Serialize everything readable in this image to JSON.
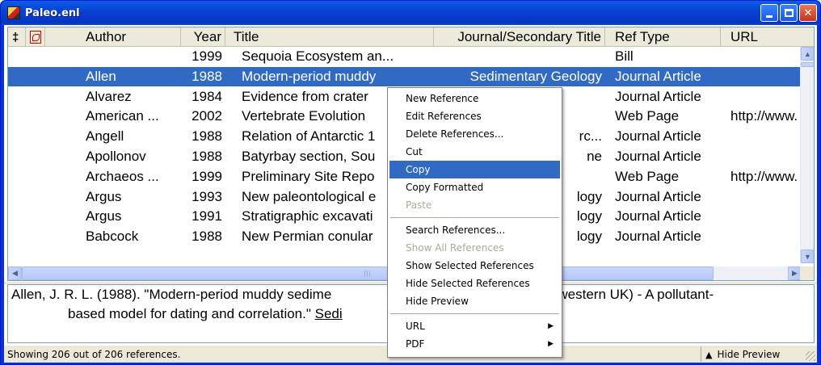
{
  "window": {
    "title": "Paleo.enl"
  },
  "columns": {
    "attach_icon": "paperclip-icon",
    "pdf_icon": "pdf-icon",
    "author": "Author",
    "year": "Year",
    "title": "Title",
    "journal": "Journal/Secondary Title",
    "reftype": "Ref Type",
    "url": "URL"
  },
  "rows": [
    {
      "author": "",
      "year": "1999",
      "title": "Sequoia Ecosystem an...",
      "journal": "",
      "reftype": "Bill",
      "url": ""
    },
    {
      "author": "Allen",
      "year": "1988",
      "title": "Modern-period muddy ",
      "journal": "Sedimentary Geology",
      "reftype": "Journal Article",
      "url": ""
    },
    {
      "author": "Alvarez",
      "year": "1984",
      "title": "Evidence from crater",
      "journal": "",
      "reftype": "Journal Article",
      "url": ""
    },
    {
      "author": "American ...",
      "year": "2002",
      "title": "Vertebrate Evolution",
      "journal": "",
      "reftype": "Web Page",
      "url": "http://www."
    },
    {
      "author": "Angell",
      "year": "1988",
      "title": "Relation of Antarctic 1",
      "journal": "rc...",
      "reftype": "Journal Article",
      "url": ""
    },
    {
      "author": "Apollonov",
      "year": "1988",
      "title": "Batyrbay section, Sou",
      "journal": "ne",
      "reftype": "Journal Article",
      "url": ""
    },
    {
      "author": "Archaeos ...",
      "year": "1999",
      "title": "Preliminary Site Repo",
      "journal": "",
      "reftype": "Web Page",
      "url": "http://www."
    },
    {
      "author": "Argus",
      "year": "1993",
      "title": "New paleontological e",
      "journal": "logy",
      "reftype": "Journal Article",
      "url": ""
    },
    {
      "author": "Argus",
      "year": "1991",
      "title": "Stratigraphic excavati",
      "journal": "logy",
      "reftype": "Journal Article",
      "url": ""
    },
    {
      "author": "Babcock",
      "year": "1988",
      "title": "New Permian conular",
      "journal": "logy",
      "reftype": "Journal Article",
      "url": ""
    }
  ],
  "selected_row": 1,
  "preview": {
    "line1": "Allen, J. R. L. (1988). \"Modern-period muddy sedime",
    "line1_tail": "(Southwestern UK) - A pollutant-",
    "line2": "based model for dating and correlation.\" ",
    "line2_link": "Sedi",
    "line2_tail": "."
  },
  "status": {
    "text": "Showing 206 out of 206 references.",
    "hide_preview": "Hide Preview"
  },
  "context_menu": {
    "items": [
      {
        "label": "New Reference"
      },
      {
        "label": "Edit References"
      },
      {
        "label": "Delete References..."
      },
      {
        "label": "Cut"
      },
      {
        "label": "Copy"
      },
      {
        "label": "Copy Formatted"
      },
      {
        "label": "Paste"
      },
      {
        "label": "Search References..."
      },
      {
        "label": "Show All References"
      },
      {
        "label": "Show Selected References"
      },
      {
        "label": "Hide Selected References"
      },
      {
        "label": "Hide Preview"
      },
      {
        "label": "URL"
      },
      {
        "label": "PDF"
      }
    ],
    "highlighted": "Copy"
  },
  "colors": {
    "selection": "#316ac5",
    "titlebar": "#0a46d6",
    "disabled_text": "#aca899"
  }
}
